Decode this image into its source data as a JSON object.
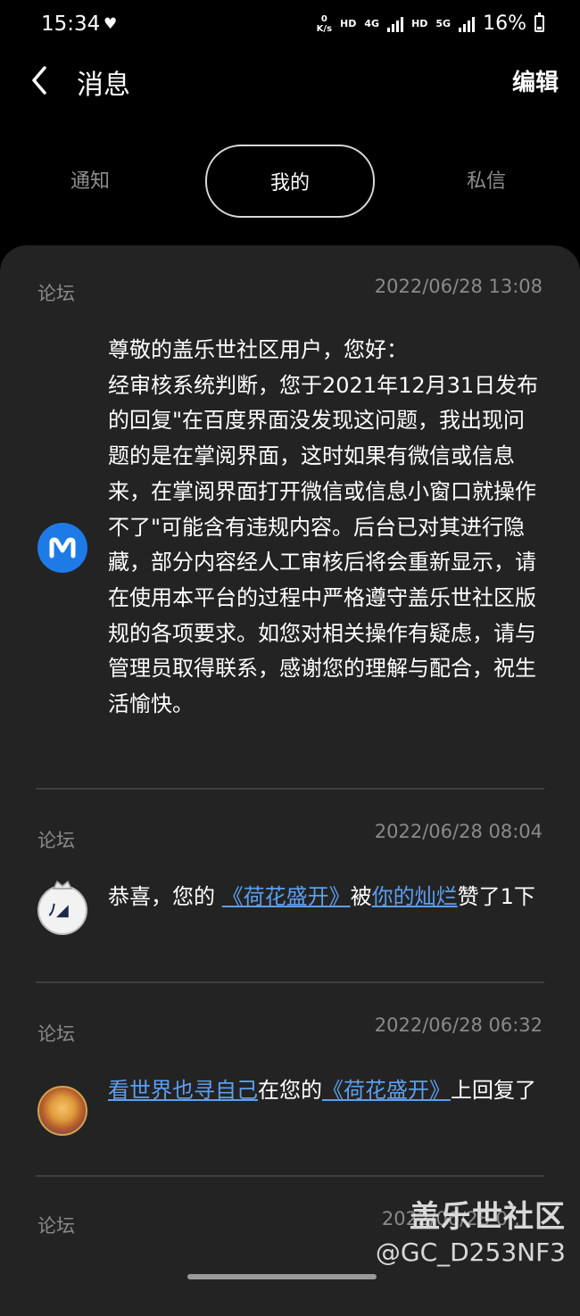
{
  "status_bar": {
    "time": "15:34",
    "heart_icon": "♥",
    "speed_value": "0",
    "speed_unit": "K/s",
    "hd1": "HD",
    "net": "4G",
    "hd2": "HD",
    "net2": "5G",
    "battery": "16%"
  },
  "header": {
    "back_icon": "chevron-left-icon",
    "title": "消息",
    "edit_label": "编辑"
  },
  "tabs": [
    {
      "label": "通知",
      "selected": false
    },
    {
      "label": "我的",
      "selected": true
    },
    {
      "label": "私信",
      "selected": false
    }
  ],
  "messages": [
    {
      "source": "论坛",
      "time": "2022/06/28 13:08",
      "avatar_letter": "M",
      "text": "尊敬的盖乐世社区用户，您好：\n经审核系统判断，您于2021年12月31日发布的回复\"在百度界面没发现这问题，我出现问题的是在掌阅界面，这时如果有微信或信息来，在掌阅界面打开微信或信息小窗口就操作不了\"可能含有违规内容。后台已对其进行隐藏，部分内容经人工审核后将会重新显示，请在使用本平台的过程中严格遵守盖乐世社区版规的各项要求。如您对相关操作有疑虑，请与管理员取得联系，感谢您的理解与配合，祝生活愉快。"
    },
    {
      "source": "论坛",
      "time": "2022/06/28 08:04",
      "text_prefix": "恭喜，您的 ",
      "link1": "《荷花盛开》",
      "text_mid": "被",
      "link2": "你的灿烂",
      "text_suffix": "赞了1下"
    },
    {
      "source": "论坛",
      "time": "2022/06/28 06:32",
      "link1": "看世界也寻自己",
      "text_mid": "在您的",
      "link2": "《荷花盛开》",
      "text_suffix": "上回复了"
    },
    {
      "source": "论坛",
      "time": "2022/06/28 0…"
    }
  ],
  "watermark": {
    "line1": "盖乐世社区",
    "line2": "@GC_D253NF3"
  },
  "colors": {
    "background": "#000000",
    "panel": "#232323",
    "link": "#5b9ff0",
    "secondary_text": "#8a8a8a",
    "avatar_m": "#1e7ae6"
  }
}
